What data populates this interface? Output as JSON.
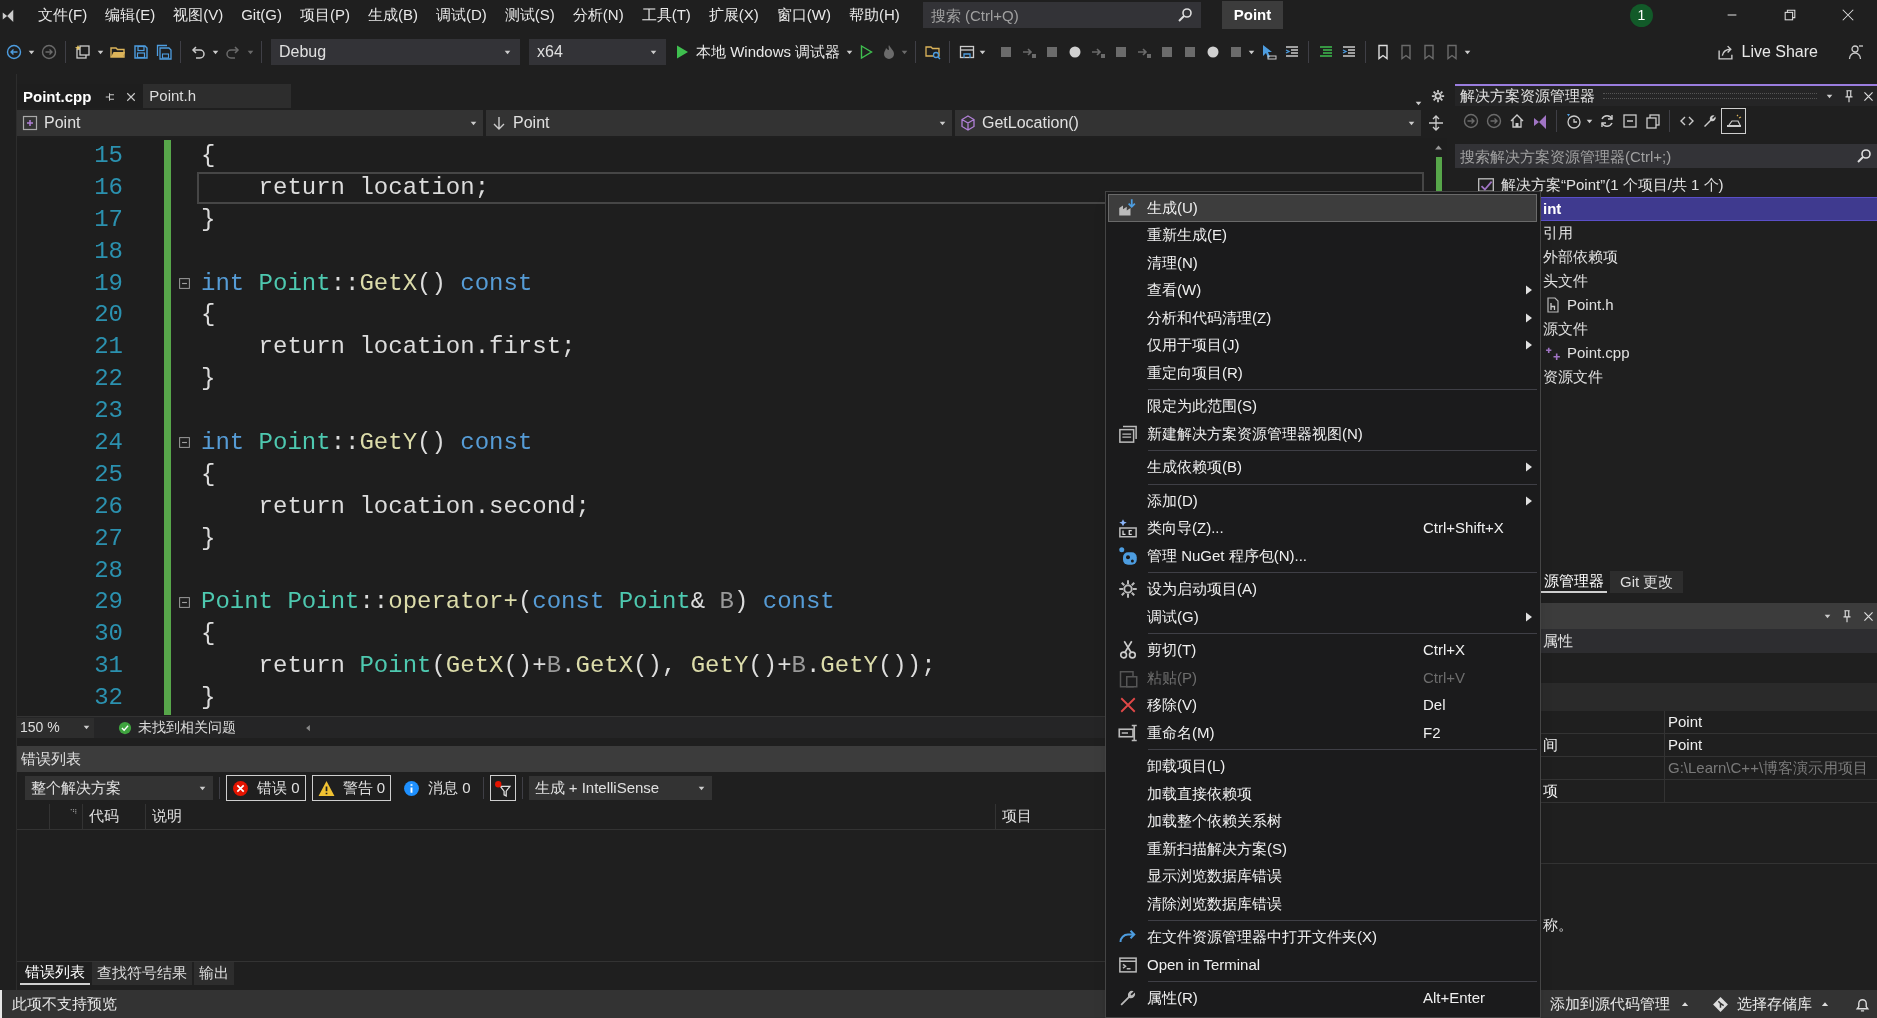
{
  "title_bar": {
    "menus": [
      "文件(F)",
      "编辑(E)",
      "视图(V)",
      "Git(G)",
      "项目(P)",
      "生成(B)",
      "调试(D)",
      "测试(S)",
      "分析(N)",
      "工具(T)",
      "扩展(X)",
      "窗口(W)",
      "帮助(H)"
    ],
    "search": {
      "placeholder": "搜索 (Ctrl+Q)"
    },
    "solution_name": "Point",
    "notification_count": "1"
  },
  "toolbar": {
    "configuration": "Debug",
    "platform": "x64",
    "debugger": "本地 Windows 调试器",
    "live_share": "Live Share"
  },
  "editor": {
    "tabs": [
      {
        "label": "Point.cpp",
        "selected": true
      },
      {
        "label": "Point.h",
        "selected": false
      }
    ],
    "nav": [
      "Point",
      "Point",
      "GetLocation()"
    ],
    "lines": [
      {
        "number": "15",
        "foldable": false,
        "current": false,
        "tokens": [
          {
            "kind": "plain",
            "text": "{"
          }
        ]
      },
      {
        "number": "16",
        "foldable": false,
        "current": true,
        "tokens": [
          {
            "kind": "plain",
            "text": "    return location;"
          }
        ]
      },
      {
        "number": "17",
        "foldable": false,
        "current": false,
        "tokens": [
          {
            "kind": "plain",
            "text": "}"
          }
        ]
      },
      {
        "number": "18",
        "foldable": false,
        "current": false
      },
      {
        "number": "19",
        "foldable": true,
        "current": false,
        "tokens": [
          {
            "kind": "keyword",
            "text": "int "
          },
          {
            "kind": "type",
            "text": "Point"
          },
          {
            "kind": "plain",
            "text": "::"
          },
          {
            "kind": "function",
            "text": "GetX"
          },
          {
            "kind": "plain",
            "text": "() "
          },
          {
            "kind": "keyword",
            "text": "const"
          }
        ]
      },
      {
        "number": "20",
        "foldable": false,
        "current": false,
        "tokens": [
          {
            "kind": "plain",
            "text": "{"
          }
        ]
      },
      {
        "number": "21",
        "foldable": false,
        "current": false,
        "tokens": [
          {
            "kind": "plain",
            "text": "    return location.first;"
          }
        ]
      },
      {
        "number": "22",
        "foldable": false,
        "current": false,
        "tokens": [
          {
            "kind": "plain",
            "text": "}"
          }
        ]
      },
      {
        "number": "23",
        "foldable": false,
        "current": false
      },
      {
        "number": "24",
        "foldable": true,
        "current": false,
        "tokens": [
          {
            "kind": "keyword",
            "text": "int "
          },
          {
            "kind": "type",
            "text": "Point"
          },
          {
            "kind": "plain",
            "text": "::"
          },
          {
            "kind": "function",
            "text": "GetY"
          },
          {
            "kind": "plain",
            "text": "() "
          },
          {
            "kind": "keyword",
            "text": "const"
          }
        ]
      },
      {
        "number": "25",
        "foldable": false,
        "current": false,
        "tokens": [
          {
            "kind": "plain",
            "text": "{"
          }
        ]
      },
      {
        "number": "26",
        "foldable": false,
        "current": false,
        "tokens": [
          {
            "kind": "plain",
            "text": "    return location.second;"
          }
        ]
      },
      {
        "number": "27",
        "foldable": false,
        "current": false,
        "tokens": [
          {
            "kind": "plain",
            "text": "}"
          }
        ]
      },
      {
        "number": "28",
        "foldable": false,
        "current": false
      },
      {
        "number": "29",
        "foldable": true,
        "current": false,
        "tokens": [
          {
            "kind": "type",
            "text": "Point "
          },
          {
            "kind": "type",
            "text": "Point"
          },
          {
            "kind": "plain",
            "text": "::"
          },
          {
            "kind": "function",
            "text": "operator+"
          },
          {
            "kind": "plain",
            "text": "("
          },
          {
            "kind": "keyword",
            "text": "const "
          },
          {
            "kind": "type",
            "text": "Point"
          },
          {
            "kind": "plain",
            "text": "& "
          },
          {
            "kind": "param",
            "text": "B"
          },
          {
            "kind": "plain",
            "text": ") "
          },
          {
            "kind": "keyword",
            "text": "const"
          }
        ]
      },
      {
        "number": "30",
        "foldable": false,
        "current": false,
        "tokens": [
          {
            "kind": "plain",
            "text": "{"
          }
        ]
      },
      {
        "number": "31",
        "foldable": false,
        "current": false,
        "tokens": [
          {
            "kind": "plain",
            "text": "    return "
          },
          {
            "kind": "type",
            "text": "Point"
          },
          {
            "kind": "plain",
            "text": "("
          },
          {
            "kind": "function",
            "text": "GetX"
          },
          {
            "kind": "plain",
            "text": "()+"
          },
          {
            "kind": "param",
            "text": "B"
          },
          {
            "kind": "plain",
            "text": "."
          },
          {
            "kind": "function",
            "text": "GetX"
          },
          {
            "kind": "plain",
            "text": "(), "
          },
          {
            "kind": "function",
            "text": "GetY"
          },
          {
            "kind": "plain",
            "text": "()+"
          },
          {
            "kind": "param",
            "text": "B"
          },
          {
            "kind": "plain",
            "text": "."
          },
          {
            "kind": "function",
            "text": "GetY"
          },
          {
            "kind": "plain",
            "text": "());"
          }
        ]
      },
      {
        "number": "32",
        "foldable": false,
        "current": false,
        "tokens": [
          {
            "kind": "plain",
            "text": "}"
          }
        ]
      }
    ],
    "zoom": "150 %",
    "issues": "未找到相关问题"
  },
  "error_list": {
    "title": "错误列表",
    "scope": "整个解决方案",
    "filters": [
      {
        "kind": "error",
        "label": "错误 0",
        "selected": true
      },
      {
        "kind": "warning",
        "label": "警告 0",
        "selected": true
      },
      {
        "kind": "message",
        "label": "消息 0",
        "selected": false
      }
    ],
    "source": "生成 + IntelliSense",
    "columns": [
      "代码",
      "说明",
      "项目"
    ],
    "tabs": [
      {
        "label": "错误列表",
        "selected": true
      },
      {
        "label": "查找符号结果",
        "selected": false
      },
      {
        "label": "输出",
        "selected": false
      }
    ]
  },
  "solution_explorer": {
    "title": "解决方案资源管理器",
    "search": {
      "placeholder": "搜索解决方案资源管理器(Ctrl+;)"
    },
    "tree": [
      {
        "kind": "solution",
        "label": "解决方案“Point”(1 个项目/共 1 个)",
        "selected": false,
        "children": [
          {
            "label": "int",
            "selected": true,
            "children": [
              {
                "label": "引用",
                "selected": false
              },
              {
                "label": "外部依赖项",
                "selected": false
              },
              {
                "label": "头文件",
                "selected": false,
                "children": [
                  {
                    "kind": "header",
                    "label": "Point.h",
                    "selected": false
                  }
                ]
              },
              {
                "label": "源文件",
                "selected": false,
                "children": [
                  {
                    "kind": "source",
                    "label": "Point.cpp",
                    "selected": false
                  }
                ]
              },
              {
                "label": "资源文件",
                "selected": false
              }
            ]
          }
        ]
      }
    ],
    "tabs": [
      {
        "label": "源管理器",
        "selected": true
      },
      {
        "label": "Git 更改",
        "selected": false
      }
    ]
  },
  "properties": {
    "header": "属性",
    "rows": [
      {
        "value": "Point",
        "disabled": false
      },
      {
        "name": "间",
        "value": "Point",
        "disabled": false
      },
      {
        "value": "G:\\Learn\\C++\\博客演示用项目",
        "disabled": true
      },
      {
        "name": "项",
        "disabled": false
      }
    ],
    "description": "称。"
  },
  "context_menu": {
    "items": [
      {
        "kind": "item",
        "label": "生成(U)",
        "submenu": false,
        "disabled": false,
        "selected": true
      },
      {
        "kind": "item",
        "label": "重新生成(E)",
        "submenu": false,
        "disabled": false,
        "selected": false
      },
      {
        "kind": "item",
        "label": "清理(N)",
        "submenu": false,
        "disabled": false,
        "selected": false
      },
      {
        "kind": "item",
        "label": "查看(W)",
        "submenu": true,
        "disabled": false,
        "selected": false
      },
      {
        "kind": "item",
        "label": "分析和代码清理(Z)",
        "submenu": true,
        "disabled": false,
        "selected": false
      },
      {
        "kind": "item",
        "label": "仅用于项目(J)",
        "submenu": true,
        "disabled": false,
        "selected": false
      },
      {
        "kind": "item",
        "label": "重定向项目(R)",
        "submenu": false,
        "disabled": false,
        "selected": false
      },
      {
        "kind": "separator"
      },
      {
        "kind": "item",
        "label": "限定为此范围(S)",
        "submenu": false,
        "disabled": false,
        "selected": false
      },
      {
        "kind": "item",
        "label": "新建解决方案资源管理器视图(N)",
        "submenu": false,
        "disabled": false,
        "selected": false
      },
      {
        "kind": "separator"
      },
      {
        "kind": "item",
        "label": "生成依赖项(B)",
        "submenu": true,
        "disabled": false,
        "selected": false
      },
      {
        "kind": "separator"
      },
      {
        "kind": "item",
        "label": "添加(D)",
        "submenu": true,
        "disabled": false,
        "selected": false
      },
      {
        "kind": "item",
        "label": "类向导(Z)...",
        "shortcut": "Ctrl+Shift+X",
        "submenu": false,
        "disabled": false,
        "selected": false
      },
      {
        "kind": "item",
        "label": "管理 NuGet 程序包(N)...",
        "submenu": false,
        "disabled": false,
        "selected": false
      },
      {
        "kind": "separator"
      },
      {
        "kind": "item",
        "label": "设为启动项目(A)",
        "submenu": false,
        "disabled": false,
        "selected": false
      },
      {
        "kind": "item",
        "label": "调试(G)",
        "submenu": true,
        "disabled": false,
        "selected": false
      },
      {
        "kind": "separator"
      },
      {
        "kind": "item",
        "label": "剪切(T)",
        "shortcut": "Ctrl+X",
        "submenu": false,
        "disabled": false,
        "selected": false
      },
      {
        "kind": "item",
        "label": "粘贴(P)",
        "shortcut": "Ctrl+V",
        "submenu": false,
        "disabled": true,
        "selected": false
      },
      {
        "kind": "item",
        "label": "移除(V)",
        "shortcut": "Del",
        "submenu": false,
        "disabled": false,
        "selected": false
      },
      {
        "kind": "item",
        "label": "重命名(M)",
        "shortcut": "F2",
        "submenu": false,
        "disabled": false,
        "selected": false
      },
      {
        "kind": "separator"
      },
      {
        "kind": "item",
        "label": "卸载项目(L)",
        "submenu": false,
        "disabled": false,
        "selected": false
      },
      {
        "kind": "item",
        "label": "加载直接依赖项",
        "submenu": false,
        "disabled": false,
        "selected": false
      },
      {
        "kind": "item",
        "label": "加载整个依赖关系树",
        "submenu": false,
        "disabled": false,
        "selected": false
      },
      {
        "kind": "item",
        "label": "重新扫描解决方案(S)",
        "submenu": false,
        "disabled": false,
        "selected": false
      },
      {
        "kind": "item",
        "label": "显示浏览数据库错误",
        "submenu": false,
        "disabled": false,
        "selected": false
      },
      {
        "kind": "item",
        "label": "清除浏览数据库错误",
        "submenu": false,
        "disabled": false,
        "selected": false
      },
      {
        "kind": "separator"
      },
      {
        "kind": "item",
        "label": "在文件资源管理器中打开文件夹(X)",
        "submenu": false,
        "disabled": false,
        "selected": false
      },
      {
        "kind": "item",
        "label": "Open in Terminal",
        "submenu": false,
        "disabled": false,
        "selected": false
      },
      {
        "kind": "separator"
      },
      {
        "kind": "item",
        "label": "属性(R)",
        "shortcut": "Alt+Enter",
        "submenu": false,
        "disabled": false,
        "selected": false
      }
    ]
  },
  "status_bar": {
    "message": "此项不支持预览",
    "source_control": "添加到源代码管理",
    "repository": "选择存储库"
  }
}
